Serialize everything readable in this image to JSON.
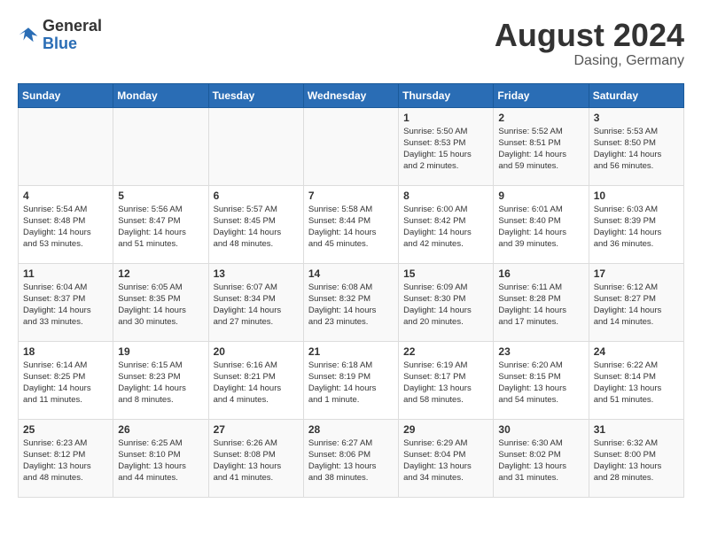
{
  "header": {
    "logo_general": "General",
    "logo_blue": "Blue",
    "month_year": "August 2024",
    "location": "Dasing, Germany"
  },
  "days_of_week": [
    "Sunday",
    "Monday",
    "Tuesday",
    "Wednesday",
    "Thursday",
    "Friday",
    "Saturday"
  ],
  "weeks": [
    [
      {
        "day": "",
        "info": ""
      },
      {
        "day": "",
        "info": ""
      },
      {
        "day": "",
        "info": ""
      },
      {
        "day": "",
        "info": ""
      },
      {
        "day": "1",
        "info": "Sunrise: 5:50 AM\nSunset: 8:53 PM\nDaylight: 15 hours\nand 2 minutes."
      },
      {
        "day": "2",
        "info": "Sunrise: 5:52 AM\nSunset: 8:51 PM\nDaylight: 14 hours\nand 59 minutes."
      },
      {
        "day": "3",
        "info": "Sunrise: 5:53 AM\nSunset: 8:50 PM\nDaylight: 14 hours\nand 56 minutes."
      }
    ],
    [
      {
        "day": "4",
        "info": "Sunrise: 5:54 AM\nSunset: 8:48 PM\nDaylight: 14 hours\nand 53 minutes."
      },
      {
        "day": "5",
        "info": "Sunrise: 5:56 AM\nSunset: 8:47 PM\nDaylight: 14 hours\nand 51 minutes."
      },
      {
        "day": "6",
        "info": "Sunrise: 5:57 AM\nSunset: 8:45 PM\nDaylight: 14 hours\nand 48 minutes."
      },
      {
        "day": "7",
        "info": "Sunrise: 5:58 AM\nSunset: 8:44 PM\nDaylight: 14 hours\nand 45 minutes."
      },
      {
        "day": "8",
        "info": "Sunrise: 6:00 AM\nSunset: 8:42 PM\nDaylight: 14 hours\nand 42 minutes."
      },
      {
        "day": "9",
        "info": "Sunrise: 6:01 AM\nSunset: 8:40 PM\nDaylight: 14 hours\nand 39 minutes."
      },
      {
        "day": "10",
        "info": "Sunrise: 6:03 AM\nSunset: 8:39 PM\nDaylight: 14 hours\nand 36 minutes."
      }
    ],
    [
      {
        "day": "11",
        "info": "Sunrise: 6:04 AM\nSunset: 8:37 PM\nDaylight: 14 hours\nand 33 minutes."
      },
      {
        "day": "12",
        "info": "Sunrise: 6:05 AM\nSunset: 8:35 PM\nDaylight: 14 hours\nand 30 minutes."
      },
      {
        "day": "13",
        "info": "Sunrise: 6:07 AM\nSunset: 8:34 PM\nDaylight: 14 hours\nand 27 minutes."
      },
      {
        "day": "14",
        "info": "Sunrise: 6:08 AM\nSunset: 8:32 PM\nDaylight: 14 hours\nand 23 minutes."
      },
      {
        "day": "15",
        "info": "Sunrise: 6:09 AM\nSunset: 8:30 PM\nDaylight: 14 hours\nand 20 minutes."
      },
      {
        "day": "16",
        "info": "Sunrise: 6:11 AM\nSunset: 8:28 PM\nDaylight: 14 hours\nand 17 minutes."
      },
      {
        "day": "17",
        "info": "Sunrise: 6:12 AM\nSunset: 8:27 PM\nDaylight: 14 hours\nand 14 minutes."
      }
    ],
    [
      {
        "day": "18",
        "info": "Sunrise: 6:14 AM\nSunset: 8:25 PM\nDaylight: 14 hours\nand 11 minutes."
      },
      {
        "day": "19",
        "info": "Sunrise: 6:15 AM\nSunset: 8:23 PM\nDaylight: 14 hours\nand 8 minutes."
      },
      {
        "day": "20",
        "info": "Sunrise: 6:16 AM\nSunset: 8:21 PM\nDaylight: 14 hours\nand 4 minutes."
      },
      {
        "day": "21",
        "info": "Sunrise: 6:18 AM\nSunset: 8:19 PM\nDaylight: 14 hours\nand 1 minute."
      },
      {
        "day": "22",
        "info": "Sunrise: 6:19 AM\nSunset: 8:17 PM\nDaylight: 13 hours\nand 58 minutes."
      },
      {
        "day": "23",
        "info": "Sunrise: 6:20 AM\nSunset: 8:15 PM\nDaylight: 13 hours\nand 54 minutes."
      },
      {
        "day": "24",
        "info": "Sunrise: 6:22 AM\nSunset: 8:14 PM\nDaylight: 13 hours\nand 51 minutes."
      }
    ],
    [
      {
        "day": "25",
        "info": "Sunrise: 6:23 AM\nSunset: 8:12 PM\nDaylight: 13 hours\nand 48 minutes."
      },
      {
        "day": "26",
        "info": "Sunrise: 6:25 AM\nSunset: 8:10 PM\nDaylight: 13 hours\nand 44 minutes."
      },
      {
        "day": "27",
        "info": "Sunrise: 6:26 AM\nSunset: 8:08 PM\nDaylight: 13 hours\nand 41 minutes."
      },
      {
        "day": "28",
        "info": "Sunrise: 6:27 AM\nSunset: 8:06 PM\nDaylight: 13 hours\nand 38 minutes."
      },
      {
        "day": "29",
        "info": "Sunrise: 6:29 AM\nSunset: 8:04 PM\nDaylight: 13 hours\nand 34 minutes."
      },
      {
        "day": "30",
        "info": "Sunrise: 6:30 AM\nSunset: 8:02 PM\nDaylight: 13 hours\nand 31 minutes."
      },
      {
        "day": "31",
        "info": "Sunrise: 6:32 AM\nSunset: 8:00 PM\nDaylight: 13 hours\nand 28 minutes."
      }
    ]
  ]
}
